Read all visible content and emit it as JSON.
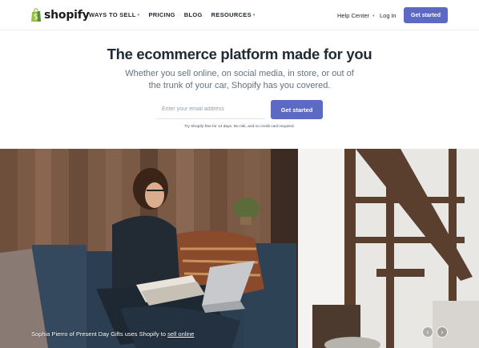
{
  "header": {
    "logo_text": "shopify",
    "nav": [
      {
        "label": "WAYS TO SELL",
        "has_dropdown": true
      },
      {
        "label": "PRICING",
        "has_dropdown": false
      },
      {
        "label": "BLOG",
        "has_dropdown": false
      },
      {
        "label": "RESOURCES",
        "has_dropdown": true
      }
    ],
    "help_label": "Help Center",
    "login_label": "Log in",
    "cta_label": "Get started"
  },
  "hero": {
    "title": "The ecommerce platform made for you",
    "subtitle": "Whether you sell online, on social media, in store, or out of the trunk of your car, Shopify has you covered.",
    "email_placeholder": "Enter your email address",
    "cta_label": "Get started",
    "trial_note": "Try Shopify free for 14 days. No risk, and no credit card required."
  },
  "photo": {
    "caption_prefix": "Sophia Pierro of Present Day Gifts uses Shopify to",
    "caption_link": "sell online",
    "prev_icon": "‹",
    "next_icon": "›"
  },
  "colors": {
    "brand_green": "#95bf47",
    "button": "#5c6ac4",
    "text": "#212b36",
    "subtext": "#637381"
  }
}
